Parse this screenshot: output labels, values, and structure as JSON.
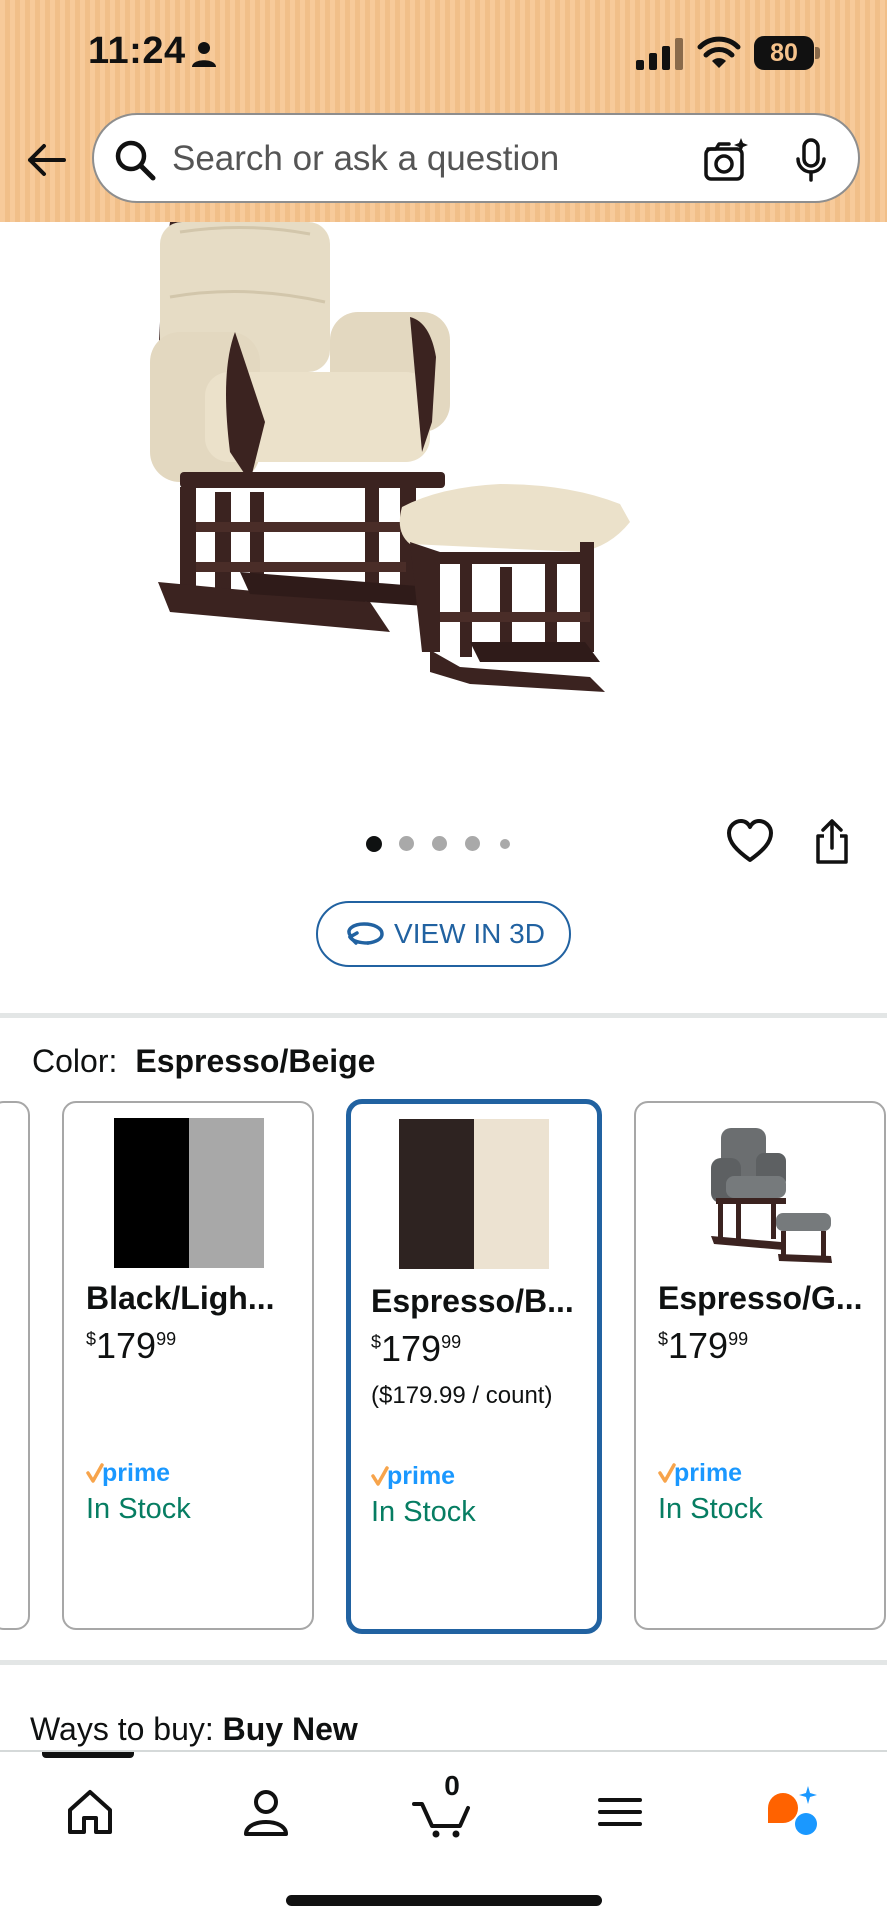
{
  "status_bar": {
    "time": "11:24",
    "battery_level": "80"
  },
  "search": {
    "placeholder": "Search or ask a question"
  },
  "image_carousel": {
    "total_images": 5,
    "current_index": 1
  },
  "view_3d": {
    "label": "VIEW IN 3D"
  },
  "color": {
    "label": "Color:",
    "selected_value": "Espresso/Beige"
  },
  "variants": [
    {
      "name": "Black/Ligh...",
      "price_symbol": "$",
      "price_whole": "179",
      "price_cents": "99",
      "unit_price": "",
      "prime": "prime",
      "availability": "In Stock",
      "swatch_colors": [
        "#000000",
        "#a8a8a8"
      ],
      "selected": false
    },
    {
      "name": "Espresso/B...",
      "price_symbol": "$",
      "price_whole": "179",
      "price_cents": "99",
      "unit_price": "($179.99 / count)",
      "prime": "prime",
      "availability": "In Stock",
      "swatch_colors": [
        "#2e2321",
        "#ece2d1"
      ],
      "selected": true
    },
    {
      "name": "Espresso/G...",
      "price_symbol": "$",
      "price_whole": "179",
      "price_cents": "99",
      "unit_price": "",
      "prime": "prime",
      "availability": "In Stock",
      "swatch_colors": [],
      "selected": false
    }
  ],
  "ways_to_buy": {
    "label": "Ways to buy:",
    "value": "Buy New"
  },
  "bottom_nav": {
    "items": [
      "home-icon",
      "account-icon",
      "cart-icon",
      "menu-icon",
      "rufus-icon"
    ],
    "cart_count": "0"
  },
  "colors": {
    "header_bg": "#f6c38c",
    "link_blue": "#2162a1",
    "in_stock_green": "#067d62",
    "prime_blue": "#1a98ff",
    "prime_orange": "#f7a44b"
  }
}
